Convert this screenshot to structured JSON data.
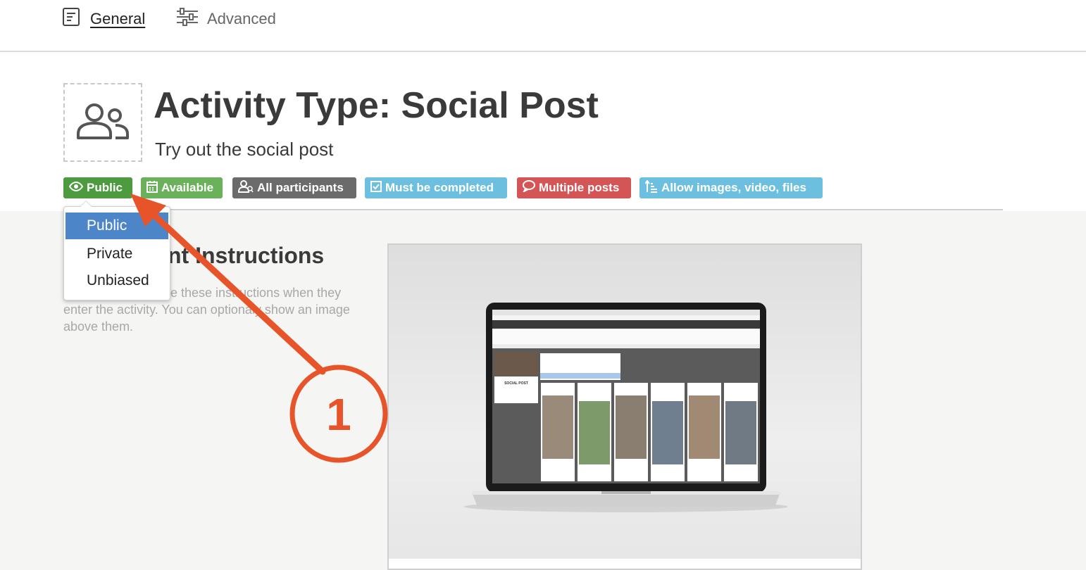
{
  "tabs": [
    {
      "label": "General",
      "icon": "document-icon",
      "active": true
    },
    {
      "label": "Advanced",
      "icon": "sliders-icon",
      "active": false
    }
  ],
  "header": {
    "icon": "users-icon",
    "title": "Activity Type: Social Post",
    "subtitle": "Try out the social post"
  },
  "badges": [
    {
      "label": "Public",
      "icon": "eye-icon",
      "color": "#4e9a3e"
    },
    {
      "label": "Available",
      "icon": "calendar-icon",
      "color": "#6bb15b"
    },
    {
      "label": "All participants",
      "icon": "user-group-icon",
      "color": "#6b6b6b"
    },
    {
      "label": "Must be completed",
      "icon": "checkbox-icon",
      "color": "#6dbfe0"
    },
    {
      "label": "Multiple posts",
      "icon": "speech-bubble-icon",
      "color": "#d45555"
    },
    {
      "label": "Allow images, video, files",
      "icon": "sort-icon",
      "color": "#6dbfe0"
    }
  ],
  "visibility_dropdown": {
    "options": [
      "Public",
      "Private",
      "Unbiased"
    ],
    "selected": "Public"
  },
  "instructions": {
    "title_visible": "nt Instructions",
    "text_fragments": [
      "e these instructions when they",
      "enter the activity. You can optional",
      "y show an image",
      "above them."
    ]
  },
  "preview": {
    "screen_heading": "SOCIAL POST"
  },
  "annotation": {
    "step_number": "1",
    "color": "#e8542a"
  }
}
